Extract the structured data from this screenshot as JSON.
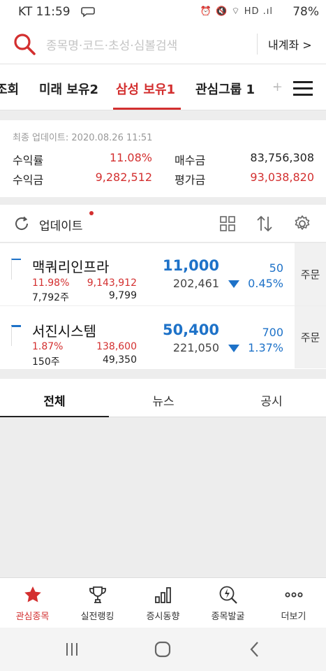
{
  "status_bar": {
    "carrier": "KT",
    "time": "11:59",
    "system_icons": "⏰ 🔇 ⌔ HD .ıl",
    "battery": "78%"
  },
  "search": {
    "placeholder": "종목명·코드·초성·심볼검색",
    "account_link": "내계좌 >"
  },
  "tabs": [
    {
      "label": "조회"
    },
    {
      "label": "미래 보유2"
    },
    {
      "label": "삼성 보유1",
      "active": true
    },
    {
      "label": "관심그룹 1"
    },
    {
      "label": "+"
    }
  ],
  "summary": {
    "updated": "최종 업데이트: 2020.08.26 11:51",
    "return_rate_label": "수익률",
    "return_rate": "11.08%",
    "purchase_label": "매수금",
    "purchase": "83,756,308",
    "profit_label": "수익금",
    "profit": "9,282,512",
    "valuation_label": "평가금",
    "valuation": "93,038,820"
  },
  "controls": {
    "update_label": "업데이트"
  },
  "stocks": [
    {
      "name": "맥쿼리인프라",
      "return_rate": "11.98%",
      "profit": "9,143,912",
      "shares": "7,792주",
      "avg_price": "9,799",
      "price": "11,000",
      "volume": "202,461",
      "change": "50",
      "change_rate": "0.45%",
      "order_label": "주문"
    },
    {
      "name": "서진시스템",
      "return_rate": "1.87%",
      "profit": "138,600",
      "shares": "150주",
      "avg_price": "49,350",
      "price": "50,400",
      "volume": "221,050",
      "change": "700",
      "change_rate": "1.37%",
      "order_label": "주문"
    }
  ],
  "news_tabs": [
    {
      "label": "전체",
      "active": true
    },
    {
      "label": "뉴스"
    },
    {
      "label": "공시"
    }
  ],
  "bottom_nav": [
    {
      "label": "관심종목",
      "icon": "star-icon",
      "active": true
    },
    {
      "label": "실전랭킹",
      "icon": "trophy-icon"
    },
    {
      "label": "증시동향",
      "icon": "bar-chart-icon"
    },
    {
      "label": "종목발굴",
      "icon": "lightning-search-icon"
    },
    {
      "label": "더보기",
      "icon": "more-icon"
    }
  ],
  "colors": {
    "accent": "#d32f2f",
    "price_down": "#1e72c8"
  }
}
